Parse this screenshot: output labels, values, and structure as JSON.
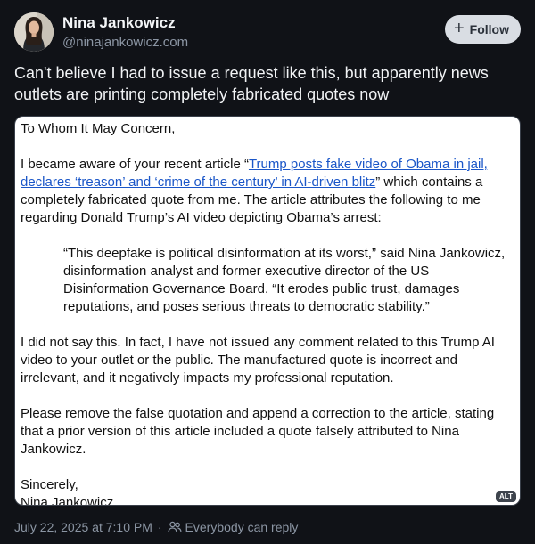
{
  "author": {
    "name": "Nina Jankowicz",
    "handle": "@ninajankowicz.com"
  },
  "follow_button": {
    "icon": "plus-icon",
    "label": "Follow"
  },
  "post_text": "Can't believe I had to issue a request like this, but apparently news outlets are printing completely fabricated quotes now",
  "image": {
    "alt_badge": "ALT",
    "letter": {
      "salutation": "To Whom It May Concern,",
      "para1_before_link": "I became aware of your recent article “",
      "para1_link": "Trump posts fake video of Obama in jail, declares ‘treason’ and ‘crime of the century’ in AI-driven blitz",
      "para1_after_link": "” which contains a completely fabricated quote from me. The article attributes the following to me regarding Donald Trump’s AI video depicting Obama’s arrest:",
      "quote": "“This deepfake is political disinformation at its worst,” said Nina Jankowicz, disinformation analyst and former executive director of the US Disinformation Governance Board. “It erodes public trust, damages reputations, and poses serious threats to democratic stability.”",
      "para2": "I did not say this. In fact, I have not issued any comment related to this Trump AI video to your outlet or the public. The manufactured quote is incorrect and irrelevant, and it negatively impacts my professional reputation.",
      "para3": "Please remove the false quotation and append a correction to the article, stating that a prior version of this article included a quote falsely attributed to Nina Jankowicz.",
      "closing": "Sincerely,",
      "signature": "Nina Jankowicz"
    }
  },
  "footer": {
    "timestamp": "July 22, 2025 at 7:10 PM",
    "separator": "·",
    "reply_icon": "people-icon",
    "reply_setting": "Everybody can reply"
  },
  "colors": {
    "background": "#101217",
    "link": "#1a56c8",
    "muted_text": "#8b95a3",
    "follow_button_bg": "#d9dde3"
  }
}
